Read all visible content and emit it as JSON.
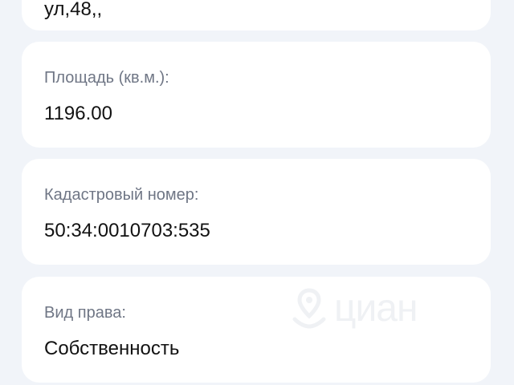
{
  "details": {
    "address_partial": "ул,48,,",
    "area": {
      "label": "Площадь (кв.м.):",
      "value": "1196.00"
    },
    "cadastral": {
      "label": "Кадастровый номер:",
      "value": "50:34:0010703:535"
    },
    "right_type": {
      "label": "Вид права:",
      "value": "Собственность"
    }
  },
  "watermark": {
    "text": "циан"
  },
  "colors": {
    "background": "#f1f4f9",
    "card": "#ffffff",
    "label": "#6f7685",
    "value": "#121212"
  }
}
